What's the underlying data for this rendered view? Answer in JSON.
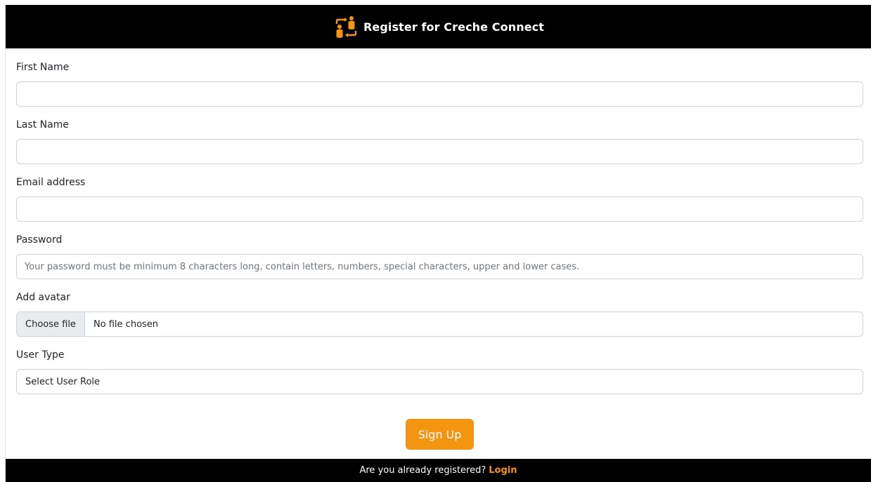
{
  "header": {
    "title": "Register for Creche Connect",
    "logo_icon": "people-exchange-icon",
    "accent_color": "#f39510"
  },
  "form": {
    "first_name": {
      "label": "First Name",
      "value": ""
    },
    "last_name": {
      "label": "Last Name",
      "value": ""
    },
    "email": {
      "label": "Email address",
      "value": ""
    },
    "password": {
      "label": "Password",
      "placeholder": "Your password must be minimum 8 characters long, contain letters, numbers, special characters, upper and lower cases."
    },
    "avatar": {
      "label": "Add avatar",
      "button_label": "Choose file",
      "status": "No file chosen"
    },
    "user_type": {
      "label": "User Type",
      "selected": "Select User Role"
    },
    "submit_label": "Sign Up"
  },
  "footer": {
    "prompt": "Are you already registered?",
    "link_label": "Login"
  }
}
